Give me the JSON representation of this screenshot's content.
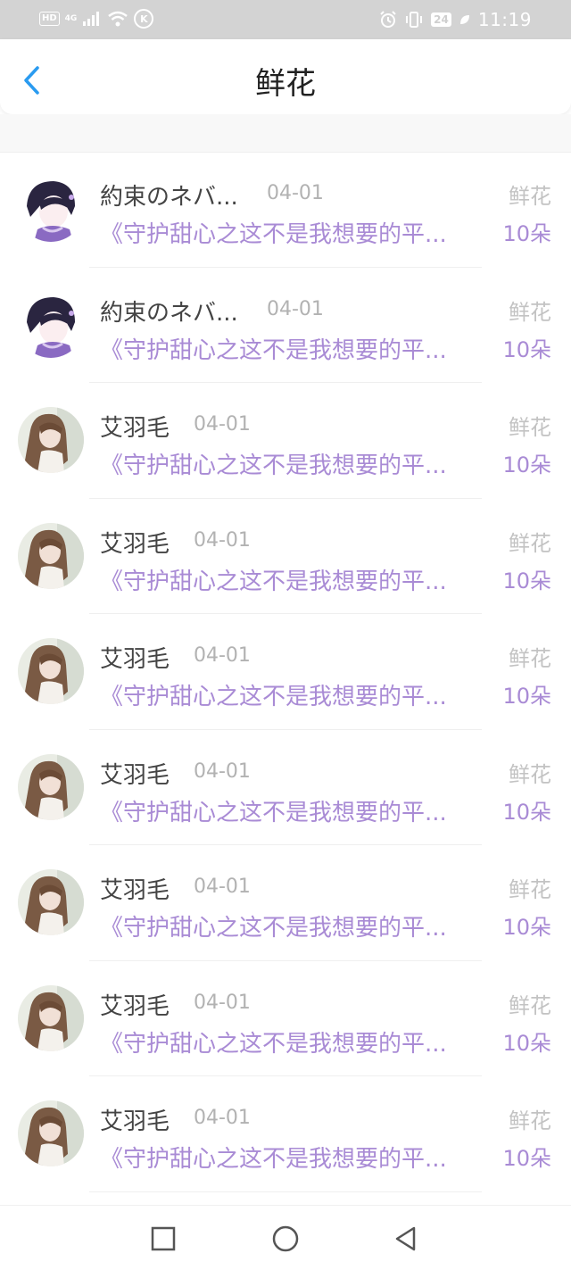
{
  "status_bar": {
    "hd": "HD",
    "network": "4G",
    "k_badge": "K",
    "battery": "24",
    "time": "11:19"
  },
  "header": {
    "title": "鲜花"
  },
  "list": [
    {
      "name": "約束のネバ...",
      "date": "04-01",
      "gift_type": "鲜花",
      "message": "《守护甜心之这不是我想要的平...",
      "count": "10朵",
      "avatar": "dark-hair-character"
    },
    {
      "name": "約束のネバ...",
      "date": "04-01",
      "gift_type": "鲜花",
      "message": "《守护甜心之这不是我想要的平...",
      "count": "10朵",
      "avatar": "dark-hair-character"
    },
    {
      "name": "艾羽毛",
      "date": "04-01",
      "gift_type": "鲜花",
      "message": "《守护甜心之这不是我想要的平...",
      "count": "10朵",
      "avatar": "brown-hair-girl"
    },
    {
      "name": "艾羽毛",
      "date": "04-01",
      "gift_type": "鲜花",
      "message": "《守护甜心之这不是我想要的平...",
      "count": "10朵",
      "avatar": "brown-hair-girl"
    },
    {
      "name": "艾羽毛",
      "date": "04-01",
      "gift_type": "鲜花",
      "message": "《守护甜心之这不是我想要的平...",
      "count": "10朵",
      "avatar": "brown-hair-girl"
    },
    {
      "name": "艾羽毛",
      "date": "04-01",
      "gift_type": "鲜花",
      "message": "《守护甜心之这不是我想要的平...",
      "count": "10朵",
      "avatar": "brown-hair-girl"
    },
    {
      "name": "艾羽毛",
      "date": "04-01",
      "gift_type": "鲜花",
      "message": "《守护甜心之这不是我想要的平...",
      "count": "10朵",
      "avatar": "brown-hair-girl"
    },
    {
      "name": "艾羽毛",
      "date": "04-01",
      "gift_type": "鲜花",
      "message": "《守护甜心之这不是我想要的平...",
      "count": "10朵",
      "avatar": "brown-hair-girl"
    },
    {
      "name": "艾羽毛",
      "date": "04-01",
      "gift_type": "鲜花",
      "message": "《守护甜心之这不是我想要的平...",
      "count": "10朵",
      "avatar": "brown-hair-girl"
    }
  ],
  "colors": {
    "accent_purple": "#a98bd5",
    "back_arrow_blue": "#2a9bf0"
  },
  "nav": {
    "icons": [
      "square-recents-icon",
      "circle-home-icon",
      "triangle-back-icon"
    ]
  }
}
